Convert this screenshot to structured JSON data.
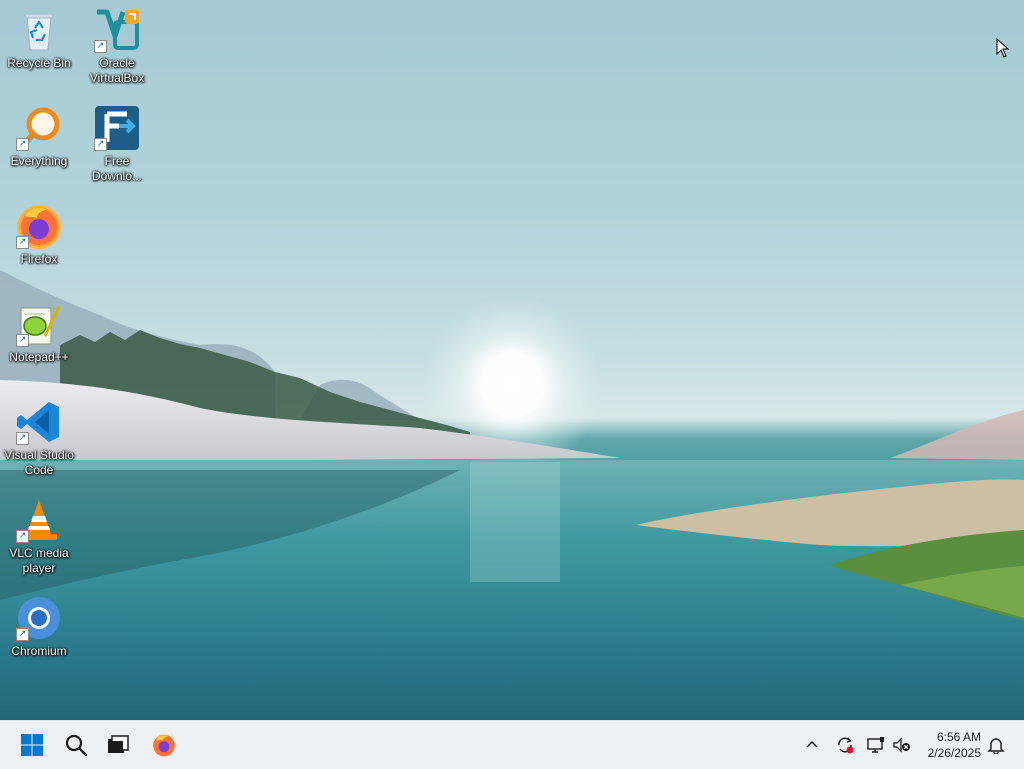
{
  "desktop": {
    "icons": [
      {
        "label": "Recycle Bin",
        "icon": "recycle-bin-icon"
      },
      {
        "label": "Oracle VirtualBox",
        "icon": "virtualbox-icon"
      },
      {
        "label": "Everything",
        "icon": "everything-search-icon"
      },
      {
        "label": "Free Downlo...",
        "icon": "free-download-manager-icon"
      },
      {
        "label": "Firefox",
        "icon": "firefox-icon"
      },
      {
        "label": "Notepad++",
        "icon": "notepad-plus-plus-icon"
      },
      {
        "label": "Visual Studio Code",
        "icon": "vscode-icon"
      },
      {
        "label": "VLC media player",
        "icon": "vlc-icon"
      },
      {
        "label": "Chromium",
        "icon": "chromium-icon"
      }
    ]
  },
  "taskbar": {
    "start": "windows-start-icon",
    "search": "search-icon",
    "task_view": "task-view-icon",
    "pinned": [
      "firefox-icon"
    ],
    "tray": {
      "overflow": "chevron-up-icon",
      "icons": [
        "sync-alert-icon",
        "display-icon",
        "volume-muted-icon"
      ],
      "time": "6:56 AM",
      "date": "2/26/2025",
      "notifications": "bell-icon"
    }
  },
  "colors": {
    "taskbar_bg": "#eef1f4",
    "start_blue": "#0078d4"
  }
}
